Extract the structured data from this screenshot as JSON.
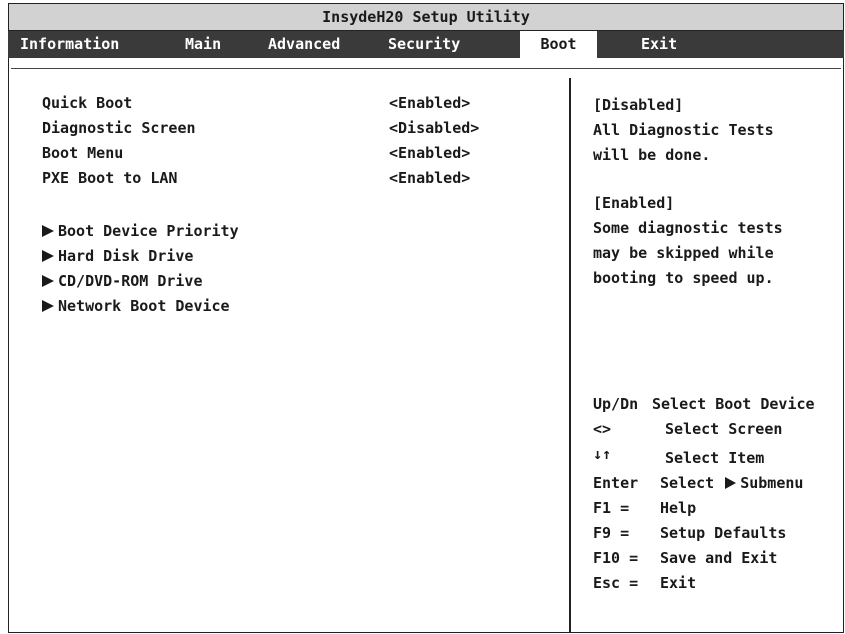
{
  "title": "InsydeH20 Setup Utility",
  "tabs": [
    {
      "label": "Information"
    },
    {
      "label": "Main"
    },
    {
      "label": "Advanced"
    },
    {
      "label": "Security"
    },
    {
      "label": "Boot",
      "active": true
    },
    {
      "label": "Exit"
    }
  ],
  "settings": [
    {
      "label": "Quick Boot",
      "value": "<Enabled>"
    },
    {
      "label": "Diagnostic Screen",
      "value": "<Disabled>"
    },
    {
      "label": "Boot Menu",
      "value": "<Enabled>"
    },
    {
      "label": "PXE Boot to LAN",
      "value": "<Enabled>"
    }
  ],
  "submenus": [
    {
      "label": "Boot Device Priority"
    },
    {
      "label": "Hard Disk Drive"
    },
    {
      "label": "CD/DVD-ROM Drive"
    },
    {
      "label": "Network Boot Device"
    }
  ],
  "help_lines": [
    "[Disabled]",
    "All Diagnostic Tests",
    "will be done.",
    "[Enabled]",
    "Some diagnostic tests",
    "may be skipped while",
    "booting to speed up."
  ],
  "keys": [
    {
      "key": "Up/Dn",
      "desc": "Select Boot Device"
    },
    {
      "key": "<>",
      "desc": "Select Screen"
    },
    {
      "key": "↓↑",
      "desc": "Select Item"
    },
    {
      "key": "Enter",
      "desc": "Select",
      "desc2": "Submenu"
    },
    {
      "key": "F1  =",
      "desc": "Help"
    },
    {
      "key": "F9  =",
      "desc": "Setup Defaults"
    },
    {
      "key": "F10 =",
      "desc": "Save and Exit"
    },
    {
      "key": "Esc =",
      "desc": "Exit"
    }
  ]
}
